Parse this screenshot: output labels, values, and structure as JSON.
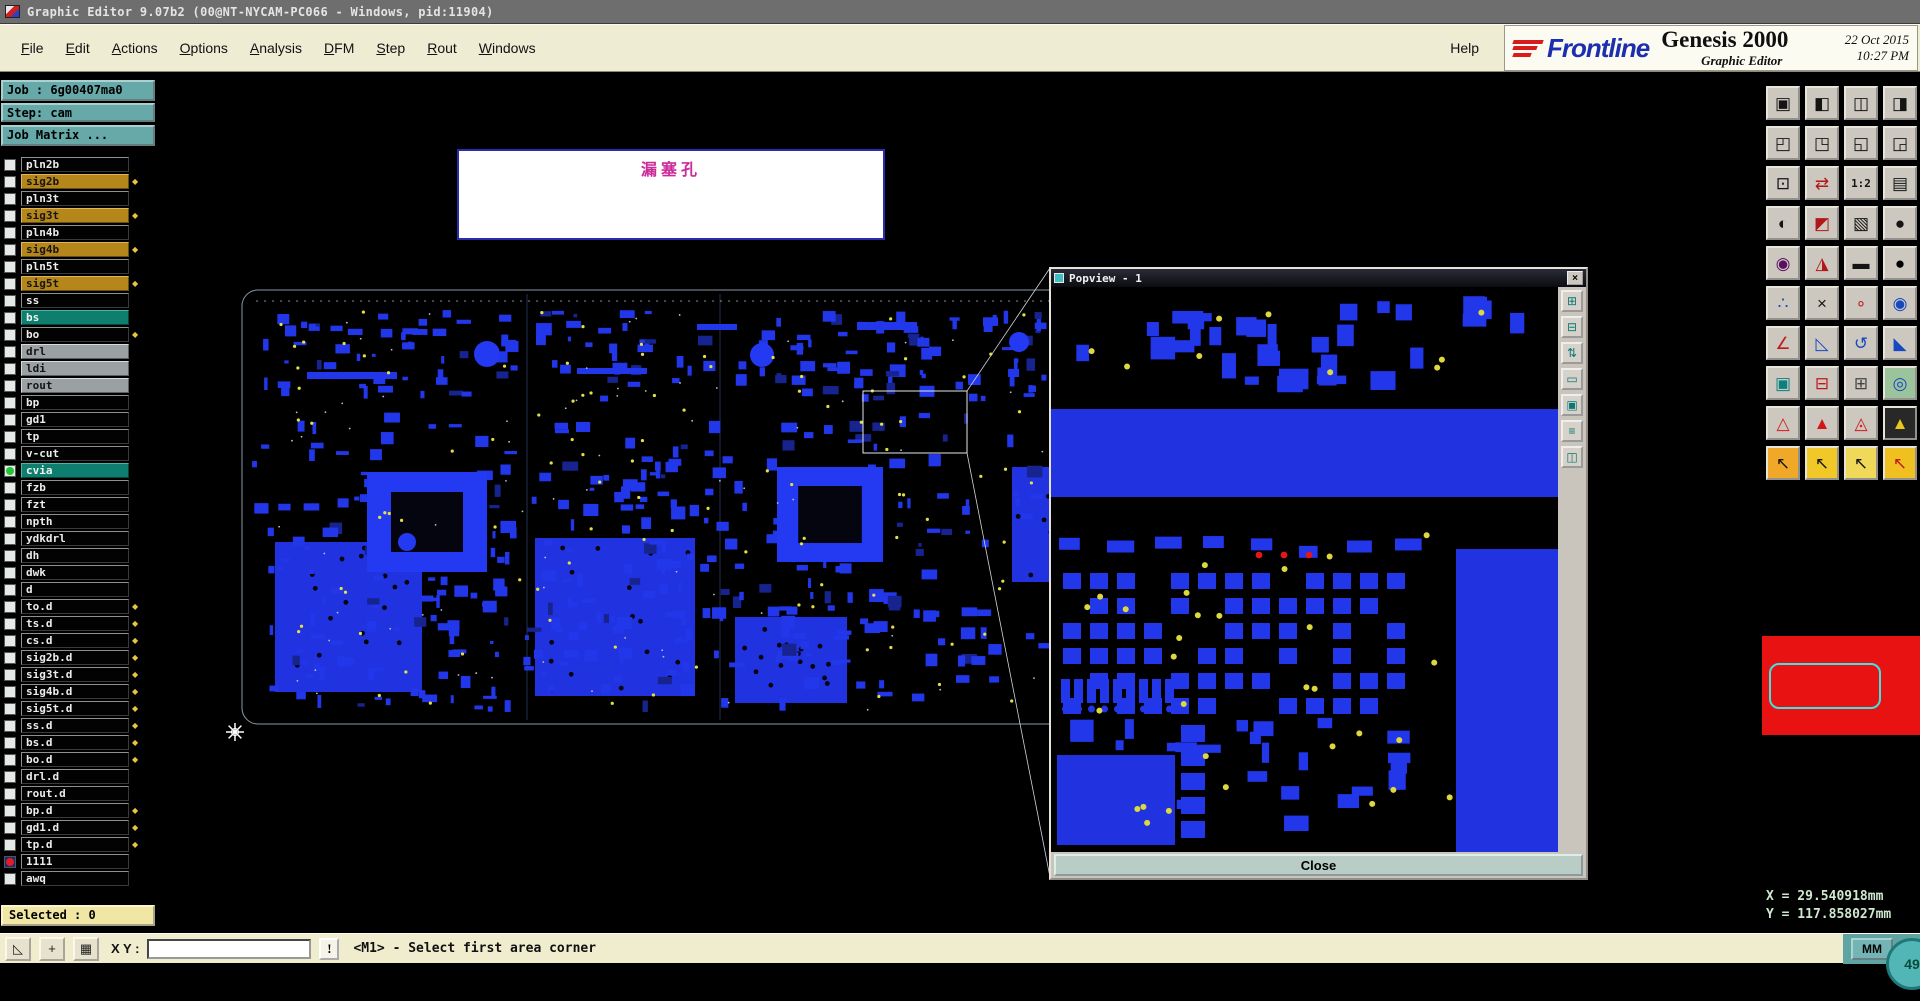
{
  "window": {
    "title": "Graphic Editor 9.07b2  (00@NT-NYCAM-PC066 - Windows, pid:11904)"
  },
  "menubar": {
    "items": [
      "File",
      "Edit",
      "Actions",
      "Options",
      "Analysis",
      "DFM",
      "Step",
      "Rout",
      "Windows"
    ],
    "help": "Help"
  },
  "branding": {
    "logo": "Frontline",
    "product": "Genesis 2000",
    "subtitle": "Graphic Editor",
    "date": "22 Oct 2015",
    "time": "10:27 PM"
  },
  "job_panel": {
    "job_label": "Job : 6g00407ma0",
    "step_label": "Step: cam",
    "matrix_label": "Job Matrix ...",
    "selected_label": "Selected : 0"
  },
  "layer_list": [
    {
      "name": "pln2b",
      "style": "black"
    },
    {
      "name": "sig2b",
      "style": "gold",
      "marker": true
    },
    {
      "name": "pln3t",
      "style": "black"
    },
    {
      "name": "sig3t",
      "style": "gold",
      "marker": true
    },
    {
      "name": "pln4b",
      "style": "black"
    },
    {
      "name": "sig4b",
      "style": "gold",
      "marker": true
    },
    {
      "name": "pln5t",
      "style": "black"
    },
    {
      "name": "sig5t",
      "style": "gold",
      "marker": true
    },
    {
      "name": "ss",
      "style": "black"
    },
    {
      "name": "bs",
      "style": "teal"
    },
    {
      "name": "bo",
      "style": "black",
      "marker": true
    },
    {
      "name": "drl",
      "style": "gray"
    },
    {
      "name": "ldi",
      "style": "gray"
    },
    {
      "name": "rout",
      "style": "gray"
    },
    {
      "name": "bp",
      "style": "black"
    },
    {
      "name": "gd1",
      "style": "black"
    },
    {
      "name": "tp",
      "style": "black"
    },
    {
      "name": "v-cut",
      "style": "black"
    },
    {
      "name": "cvia",
      "style": "teal",
      "dot": "#22c832"
    },
    {
      "name": "fzb",
      "style": "black"
    },
    {
      "name": "fzt",
      "style": "black"
    },
    {
      "name": "npth",
      "style": "black"
    },
    {
      "name": "ydkdrl",
      "style": "black"
    },
    {
      "name": "dh",
      "style": "black"
    },
    {
      "name": "dwk",
      "style": "black"
    },
    {
      "name": "d",
      "style": "black"
    },
    {
      "name": "to.d",
      "style": "black",
      "marker": true
    },
    {
      "name": "ts.d",
      "style": "black",
      "marker": true
    },
    {
      "name": "cs.d",
      "style": "black",
      "marker": true
    },
    {
      "name": "sig2b.d",
      "style": "black",
      "marker": true
    },
    {
      "name": "sig3t.d",
      "style": "black",
      "marker": true
    },
    {
      "name": "sig4b.d",
      "style": "black",
      "marker": true
    },
    {
      "name": "sig5t.d",
      "style": "black",
      "marker": true
    },
    {
      "name": "ss.d",
      "style": "black",
      "marker": true
    },
    {
      "name": "bs.d",
      "style": "black",
      "marker": true
    },
    {
      "name": "bo.d",
      "style": "black",
      "marker": true
    },
    {
      "name": "drl.d",
      "style": "black"
    },
    {
      "name": "rout.d",
      "style": "black"
    },
    {
      "name": "bp.d",
      "style": "black",
      "marker": true
    },
    {
      "name": "gd1.d",
      "style": "black",
      "marker": true
    },
    {
      "name": "tp.d",
      "style": "black",
      "marker": true
    },
    {
      "name": "1111",
      "style": "black",
      "dot": "#e02020",
      "checkbox": "#1a2a7a"
    },
    {
      "name": "awq",
      "style": "black"
    }
  ],
  "status_bar": {
    "xy_label": "X Y :",
    "xy_value": "",
    "prompt": "<M1> - Select first area corner",
    "units": "MM"
  },
  "statusbar_icons": [
    {
      "name": "snap-corner-icon",
      "g": "◺"
    },
    {
      "name": "snap-origin-icon",
      "g": "+"
    },
    {
      "name": "snap-grid-icon",
      "g": "▦"
    }
  ],
  "readout": {
    "x": "X = 29.540918mm",
    "y": "Y = 117.858027mm",
    "zoom_badge": "49"
  },
  "popview": {
    "title": "Popview - 1",
    "close_label": "Close",
    "close_glyph": "×",
    "tools": [
      {
        "name": "popview-zoom-in-icon",
        "g": "⊞"
      },
      {
        "name": "popview-zoom-out-icon",
        "g": "⊟"
      },
      {
        "name": "popview-pan-icon",
        "g": "⇅"
      },
      {
        "name": "popview-fit-icon",
        "g": "▭"
      },
      {
        "name": "popview-frame-icon",
        "g": "▣"
      },
      {
        "name": "popview-layers-icon",
        "g": "≡"
      },
      {
        "name": "popview-sync-icon",
        "g": "◫"
      }
    ]
  },
  "annotation": {
    "text": "漏塞孔"
  },
  "icons": {
    "layer_marker": "◆"
  },
  "toolbar_icons": [
    {
      "name": "view-screen-icon",
      "g": "▣",
      "c": "#141414"
    },
    {
      "name": "view-split-left-icon",
      "g": "◧",
      "c": "#141414"
    },
    {
      "name": "view-split-icon",
      "g": "◫",
      "c": "#141414"
    },
    {
      "name": "view-split-right-icon",
      "g": "◨",
      "c": "#141414"
    },
    {
      "name": "pan-up-left-icon",
      "g": "◰",
      "c": "#141414"
    },
    {
      "name": "pan-up-right-icon",
      "g": "◳",
      "c": "#141414"
    },
    {
      "name": "pan-down-left-icon",
      "g": "◱",
      "c": "#141414"
    },
    {
      "name": "pan-down-right-icon",
      "g": "◲",
      "c": "#141414"
    },
    {
      "name": "zoom-box-icon",
      "g": "⊡",
      "c": "#141414"
    },
    {
      "name": "zoom-swap-icon",
      "g": "⇄",
      "c": "#b01818"
    },
    {
      "name": "zoom-1-2-icon",
      "g": "1:2",
      "c": "#141414"
    },
    {
      "name": "layer-stack-icon",
      "g": "▤",
      "c": "#141414"
    },
    {
      "name": "negative-view-icon",
      "g": "◐",
      "c": "#141414"
    },
    {
      "name": "diagonal-split-icon",
      "g": "◩",
      "c": "#b01818"
    },
    {
      "name": "hatch-frame-icon",
      "g": "▧",
      "c": "#141414"
    },
    {
      "name": "filled-circle-icon",
      "g": "●",
      "c": "#141414"
    },
    {
      "name": "target-ring-icon",
      "g": "◉",
      "c": "#5a1060"
    },
    {
      "name": "cone-flag-icon",
      "g": "◮",
      "c": "#b01818"
    },
    {
      "name": "thick-bar-icon",
      "g": "▬",
      "c": "#141414"
    },
    {
      "name": "big-dot-icon",
      "g": "●",
      "c": "#000000"
    },
    {
      "name": "scatter-points-icon",
      "g": "∴",
      "c": "#1848c0"
    },
    {
      "name": "erase-cross-icon",
      "g": "×",
      "c": "#141414"
    },
    {
      "name": "small-rings-icon",
      "g": "∘",
      "c": "#c01818"
    },
    {
      "name": "pad-dot-icon",
      "g": "◉",
      "c": "#1848c0"
    },
    {
      "name": "measure-angle-icon",
      "g": "∠",
      "c": "#c01818"
    },
    {
      "name": "measure-slope-icon",
      "g": "◺",
      "c": "#1848c0"
    },
    {
      "name": "rotate-ccw-icon",
      "g": "↺",
      "c": "#1848c0"
    },
    {
      "name": "corner-tri-icon",
      "g": "◣",
      "c": "#1848c0"
    },
    {
      "name": "frame-target-icon",
      "g": "▣",
      "c": "#0b8080"
    },
    {
      "name": "minus-box-icon",
      "g": "⊟",
      "c": "#c01818"
    },
    {
      "name": "plus-grid-icon",
      "g": "⊞",
      "c": "#444444"
    },
    {
      "name": "ring-target-icon",
      "g": "◎",
      "c": "#1848c0",
      "b": "#9cc49c"
    },
    {
      "name": "text-a-icon",
      "g": "△",
      "c": "#d01818"
    },
    {
      "name": "text-a-slant-icon",
      "g": "▲",
      "c": "#d01818"
    },
    {
      "name": "text-a-outline-icon",
      "g": "◬",
      "c": "#d01818"
    },
    {
      "name": "text-a-negative-icon",
      "g": "▲",
      "c": "#e8c818",
      "b": "#282828"
    },
    {
      "name": "cursor-select-icon",
      "g": "↖",
      "c": "#141414",
      "b": "#f0a828"
    },
    {
      "name": "cursor-pick-icon",
      "g": "↖",
      "c": "#141414",
      "b": "#f0c828"
    },
    {
      "name": "cursor-box-icon",
      "g": "↖",
      "c": "#141414",
      "b": "#f0d858"
    },
    {
      "name": "cursor-mark-icon",
      "g": "↖",
      "c": "#c01818",
      "b": "#f0c020"
    }
  ]
}
